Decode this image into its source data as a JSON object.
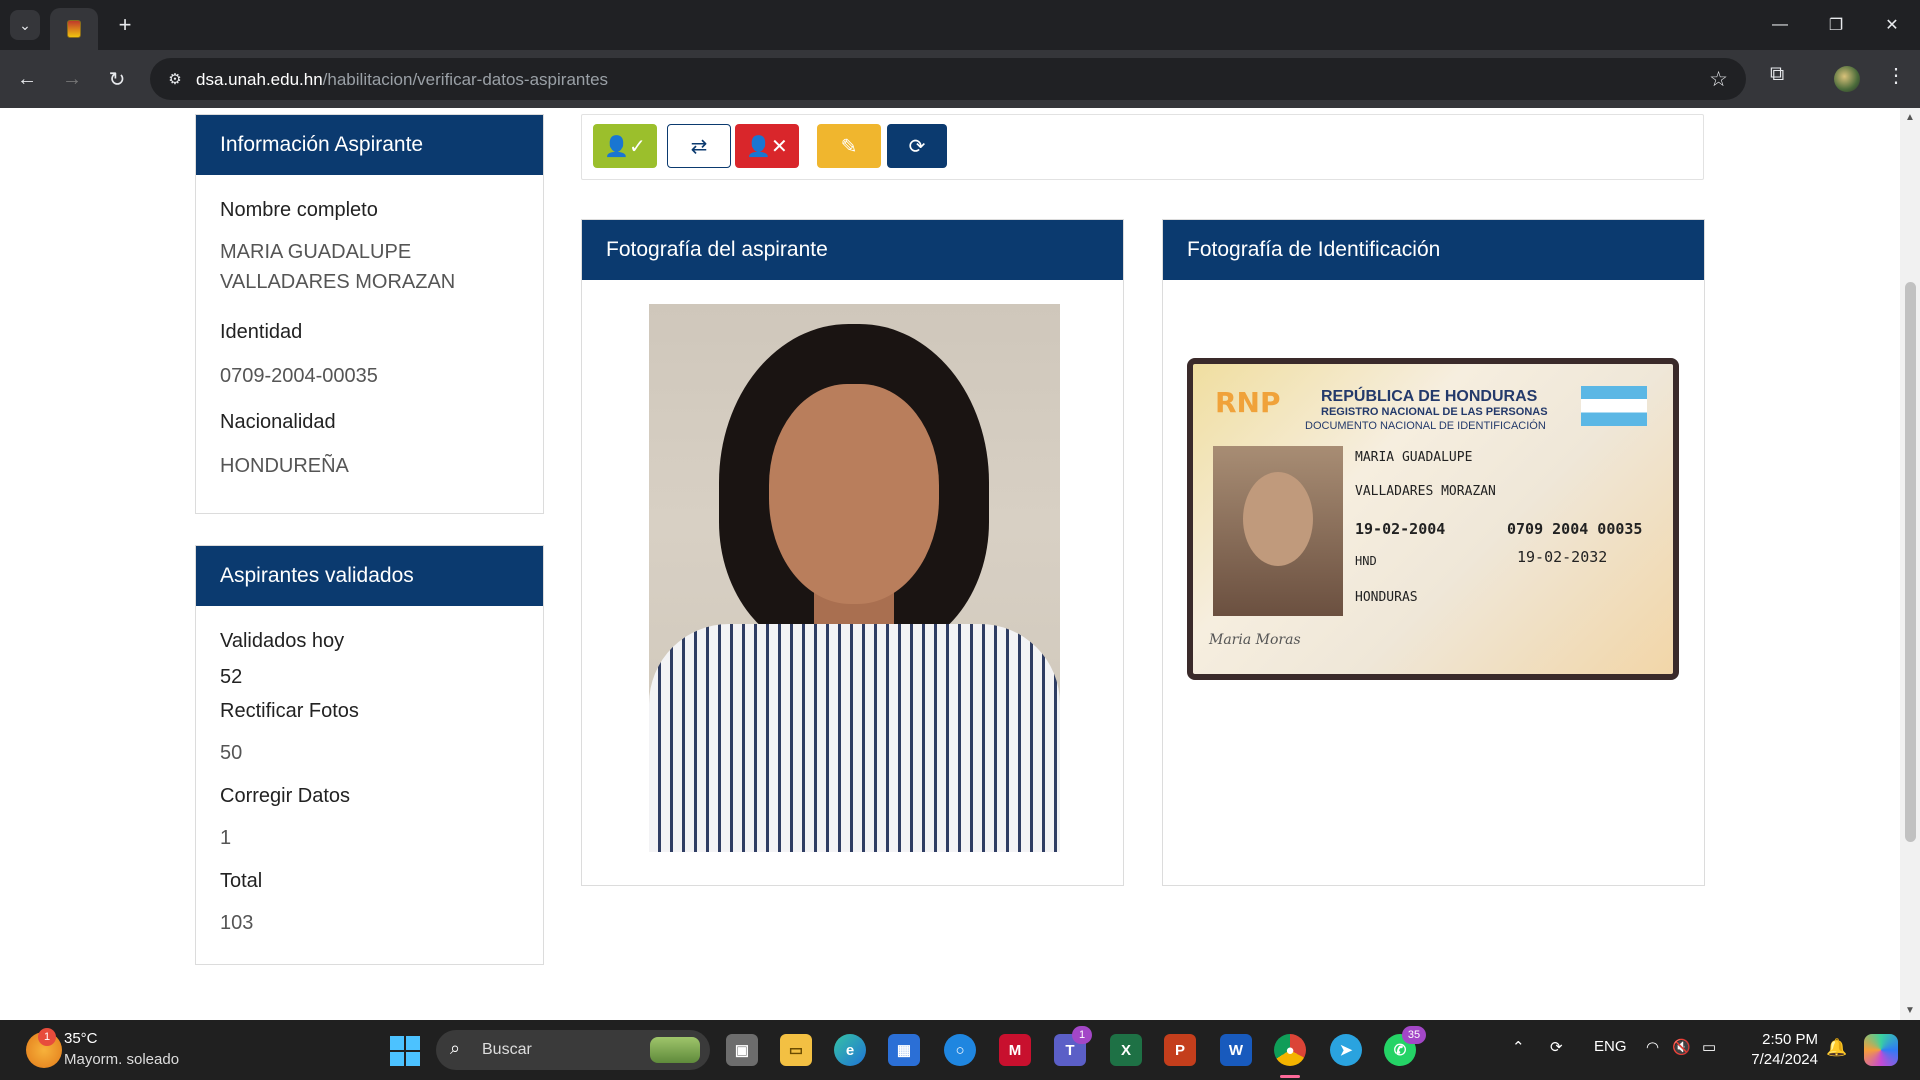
{
  "browser": {
    "url_host": "dsa.unah.edu.hn",
    "url_path": "/habilitacion/verificar-datos-aspirantes"
  },
  "sidebar": {
    "info_title": "Información Aspirante",
    "nombre_label": "Nombre completo",
    "nombre_line1": "MARIA GUADALUPE",
    "nombre_line2": "VALLADARES MORAZAN",
    "identidad_label": "Identidad",
    "identidad_value": "0709-2004-00035",
    "nacionalidad_label": "Nacionalidad",
    "nacionalidad_value": "HONDUREÑA",
    "validados_title": "Aspirantes validados",
    "validados_hoy_label": "Validados hoy",
    "validados_hoy_value": "52",
    "rectificar_label": "Rectificar Fotos",
    "rectificar_value": "50",
    "corregir_label": "Corregir Datos",
    "corregir_value": "1",
    "total_label": "Total",
    "total_value": "103"
  },
  "toolbar": {
    "buttons": [
      {
        "icon": "user-check-icon",
        "color": "#9bbf2c"
      },
      {
        "icon": "swap-icon",
        "color": "#ffffff"
      },
      {
        "icon": "user-times-icon",
        "color": "#d9262b"
      },
      {
        "icon": "edit-icon",
        "color": "#f0b62e"
      },
      {
        "icon": "refresh-icon",
        "color": "#0b3a6f"
      }
    ]
  },
  "panels": {
    "foto_aspirante_title": "Fotografía del aspirante",
    "foto_id_title": "Fotografía de Identificación"
  },
  "id_card": {
    "logo": "RNP",
    "title": "REPÚBLICA DE HONDURAS",
    "subtitle": "REGISTRO NACIONAL DE LAS PERSONAS",
    "doc": "DOCUMENTO NACIONAL DE IDENTIFICACIÓN",
    "nombre": "MARIA GUADALUPE",
    "apellido": "VALLADARES MORAZAN",
    "fecha_nac": "19-02-2004",
    "numero_id": "0709 2004 00035",
    "fecha_exp": "19-02-2032",
    "nacionalidad": "HND",
    "lugar_nac": "HONDURAS",
    "firma": "Maria Moras"
  },
  "taskbar": {
    "temp": "35°C",
    "weather_desc": "Mayorm. soleado",
    "weather_badge": "1",
    "search_placeholder": "Buscar",
    "teams_badge": "1",
    "whatsapp_badge": "35",
    "lang": "ENG",
    "time": "2:50 PM",
    "date": "7/24/2024"
  },
  "colors": {
    "header_blue": "#0b3a6f",
    "chrome_dark": "#202124"
  }
}
